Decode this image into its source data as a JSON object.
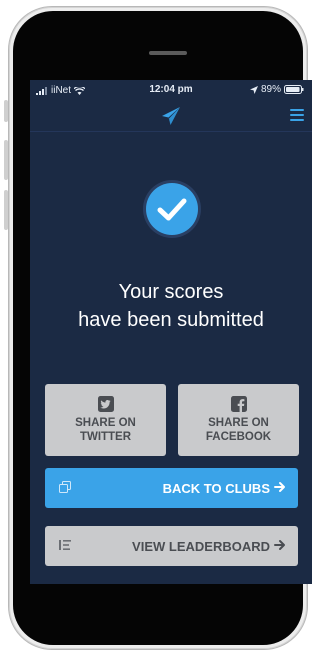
{
  "statusbar": {
    "carrier": "iiNet",
    "time": "12:04 pm",
    "battery": "89%"
  },
  "navbar": {
    "logo_icon": "paper-plane-icon",
    "menu_icon": "hamburger-menu-icon"
  },
  "confirmation": {
    "icon": "checkmark-icon",
    "line1": "Your scores",
    "line2": "have been submitted"
  },
  "share": {
    "twitter": {
      "line1": "SHARE ON",
      "line2": "TWITTER",
      "icon": "twitter-icon"
    },
    "facebook": {
      "line1": "SHARE ON",
      "line2": "FACEBOOK",
      "icon": "facebook-icon"
    }
  },
  "actions": {
    "back_to_clubs": "BACK TO CLUBS",
    "view_leaderboard": "VIEW LEADERBOARD"
  },
  "colors": {
    "background": "#1b2a44",
    "accent": "#3aa3e8",
    "button_grey": "#c9cacc"
  }
}
